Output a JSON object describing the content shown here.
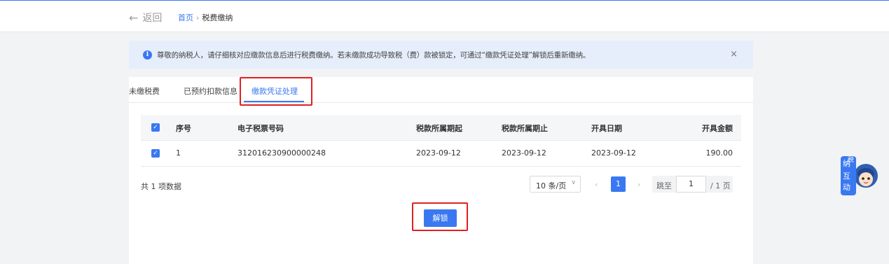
{
  "header": {
    "back_label": "返回",
    "breadcrumb": {
      "home": "首页",
      "separator": "›",
      "current": "税费缴纳"
    }
  },
  "alert": {
    "text": "尊敬的纳税人，请仔细核对应缴款信息后进行税费缴纳。若未缴款成功导致税（费）款被锁定，可通过“缴款凭证处理”解锁后重新缴纳。",
    "close": "×"
  },
  "tabs": [
    {
      "label": "未缴税费"
    },
    {
      "label": "已预约扣款信息"
    },
    {
      "label": "缴款凭证处理",
      "active": true
    }
  ],
  "table": {
    "columns": [
      "序号",
      "电子税票号码",
      "税款所属期起",
      "税款所属期止",
      "开具日期",
      "开具金额"
    ],
    "rows": [
      {
        "no": "1",
        "code": "312016230900000248",
        "start": "2023-09-12",
        "end": "2023-09-12",
        "date": "2023-09-12",
        "amount": "190.00",
        "checked": true
      }
    ]
  },
  "pagination": {
    "total": "共 1 项数据",
    "page_size": "10 条/页",
    "current_page": "1",
    "jump_label": "跳至",
    "jump_value": "1",
    "total_pages": "/ 1 页"
  },
  "actions": {
    "unlock_label": "解锁"
  },
  "assistant": {
    "label_chars": [
      "纳",
      "税",
      "互",
      "动"
    ]
  },
  "colors": {
    "accent": "#3a78f2",
    "highlight": "#e02020",
    "alert_bg": "#e6eefc"
  }
}
